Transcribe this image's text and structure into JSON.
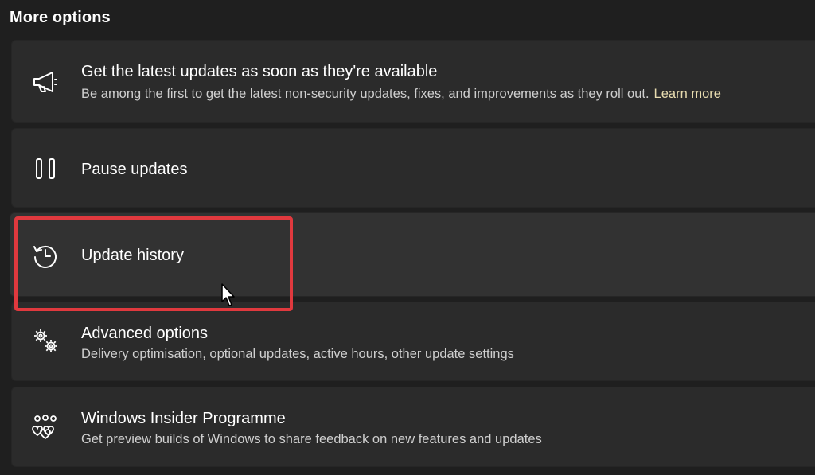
{
  "section": {
    "title": "More options"
  },
  "cards": [
    {
      "title": "Get the latest updates as soon as they're available",
      "description": "Be among the first to get the latest non-security updates, fixes, and improvements as they roll out.",
      "link": "Learn more",
      "icon": "megaphone-icon"
    },
    {
      "title": "Pause updates",
      "icon": "pause-icon"
    },
    {
      "title": "Update history",
      "icon": "history-icon"
    },
    {
      "title": "Advanced options",
      "description": "Delivery optimisation, optional updates, active hours, other update settings",
      "icon": "gears-icon"
    },
    {
      "title": "Windows Insider Programme",
      "description": "Get preview builds of Windows to share feedback on new features and updates",
      "icon": "insider-hearts-icon"
    }
  ],
  "colors": {
    "background": "#1f1f1f",
    "card": "#2b2b2b",
    "card_hover": "#323232",
    "link": "#e9ddb0",
    "highlight": "#e0393e"
  }
}
